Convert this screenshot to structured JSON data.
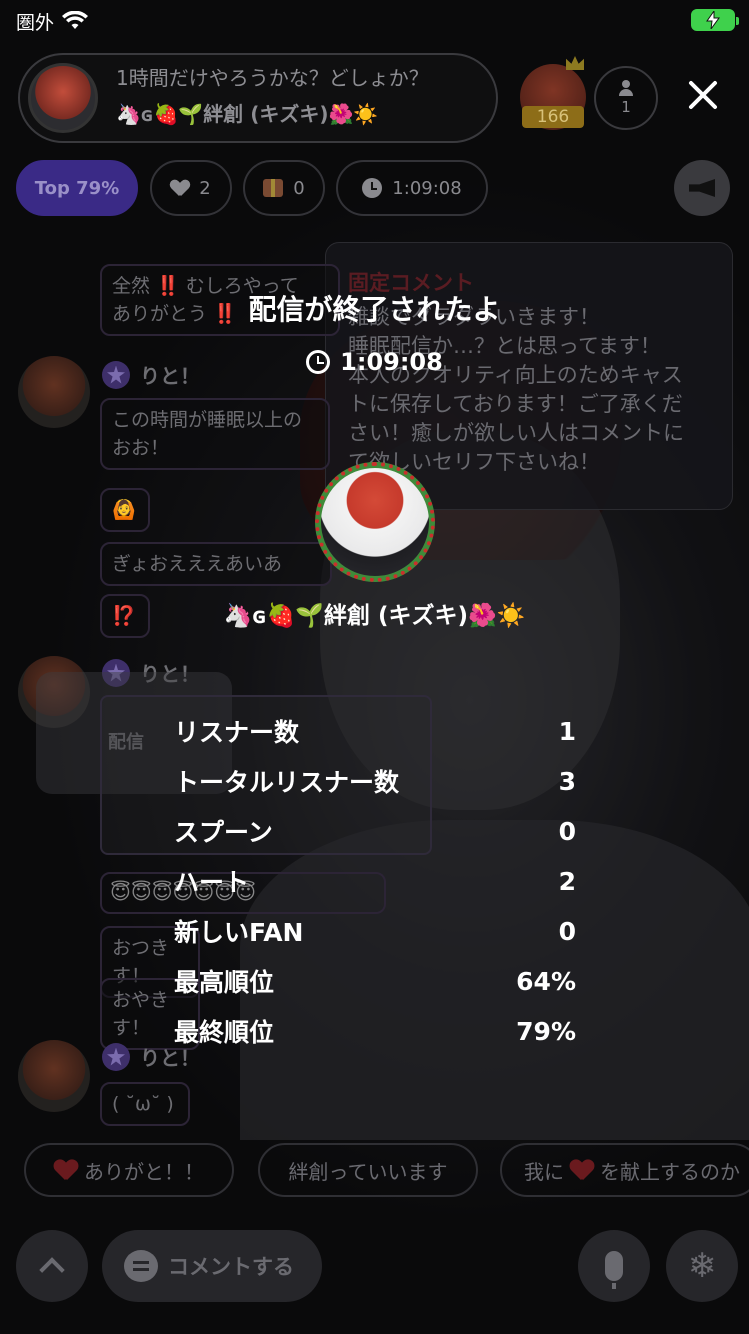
{
  "status_bar": {
    "carrier": "圏外"
  },
  "header": {
    "title": "1時間だけやろうかな？どしょか？",
    "host_name": "🦄ɢ🍓🌱絆創 (キズキ)🌺☀️",
    "top_fan_count": "166",
    "listener_count": "1"
  },
  "chips": {
    "rank": "Top 79%",
    "hearts": "2",
    "gifts": "0",
    "duration": "1:09:08"
  },
  "pinned": {
    "title": "固定コメント",
    "body": "雑談でダラダラいきます！\n睡眠配信か…？とは思ってます！\n本人のクオリティ向上のためキャス\nトに保存しております！ご了承くだ\nさい！癒しが欲しい人はコメントに\nて欲しいセリフ下さいね！"
  },
  "chat": {
    "msg1": "全然 ‼️ むしろやって\nありがとう ‼️",
    "user1": "りと！",
    "msg2": "この時間が睡眠以上の\nおお！",
    "msg3": "🙆",
    "msg4": "ぎょおえええあいあ",
    "msg5": "⁉️",
    "user2": "りと！",
    "deco_label": "配信",
    "msg6": "😇😇😇😇😇😇😇",
    "msg7": "おつきす！",
    "msg8": "おやきす！",
    "user3": "りと！",
    "msg9": "( ˘ω˘ )"
  },
  "quick_replies": {
    "r1": "ありがと！！",
    "r2": "絆創っていいます",
    "r3_a": "我に",
    "r3_b": "を献上するのか"
  },
  "bottom_bar": {
    "comment_label": "コメントする"
  },
  "end_summary": {
    "title": "配信が終了されたよ",
    "duration": "1:09:08",
    "host_name": "🦄ɢ🍓🌱絆創 (キズキ)🌺☀️",
    "stats": [
      {
        "label": "リスナー数",
        "value": "1"
      },
      {
        "label": "トータルリスナー数",
        "value": "3"
      },
      {
        "label": "スプーン",
        "value": "0"
      },
      {
        "label": "ハート",
        "value": "2"
      },
      {
        "label": "新しいFAN",
        "value": "0"
      },
      {
        "label": "最高順位",
        "value": "64%"
      },
      {
        "label": "最終順位",
        "value": "79%"
      }
    ]
  },
  "colors": {
    "accent": "#3a2a86",
    "battery": "#3fd14c",
    "avatar_ring": "#3f8b3a"
  }
}
